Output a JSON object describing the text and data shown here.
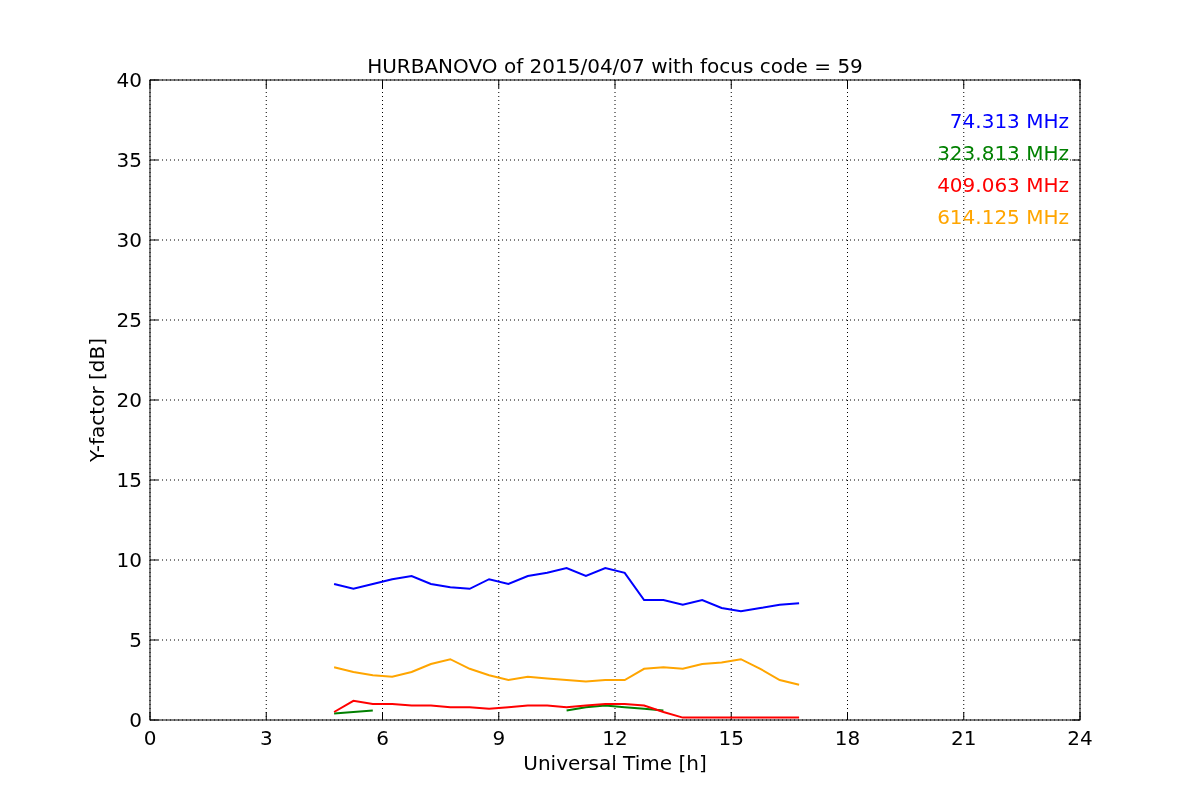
{
  "chart_data": {
    "type": "line",
    "title": "HURBANOVO of 2015/04/07 with focus code = 59",
    "xlabel": "Universal Time [h]",
    "ylabel": "Y-factor [dB]",
    "x": [
      4.75,
      5.25,
      5.75,
      6.25,
      6.75,
      7.25,
      7.75,
      8.25,
      8.75,
      9.25,
      9.75,
      10.25,
      10.75,
      11.25,
      11.75,
      12.25,
      12.75,
      13.25,
      13.75,
      14.25,
      14.75,
      15.25,
      15.75,
      16.25,
      16.75
    ],
    "series": [
      {
        "name": "74.313 MHz",
        "color": "#0000ff",
        "values": [
          8.5,
          8.2,
          8.5,
          8.8,
          9,
          8.5,
          8.3,
          8.2,
          8.8,
          8.5,
          9,
          9.2,
          9.5,
          9,
          9.5,
          9.2,
          7.5,
          7.5,
          7.2,
          7.5,
          7,
          6.8,
          7,
          7.2,
          7.3
        ]
      },
      {
        "name": "323.813 MHz",
        "color": "#008000",
        "values": [
          0.4,
          0.5,
          0.6,
          null,
          null,
          null,
          null,
          null,
          null,
          null,
          null,
          null,
          0.6,
          0.8,
          0.9,
          0.8,
          0.7,
          0.6,
          null,
          null,
          null,
          null,
          null,
          null,
          null
        ]
      },
      {
        "name": "409.063 MHz",
        "color": "#ff0000",
        "values": [
          0.5,
          1.2,
          1,
          1,
          0.9,
          0.9,
          0.8,
          0.8,
          0.7,
          0.8,
          0.9,
          0.9,
          0.8,
          0.9,
          1,
          1,
          0.9,
          0.5,
          0.15,
          0.15,
          0.15,
          0.15,
          0.15,
          0.15,
          0.15
        ]
      },
      {
        "name": "614.125 MHz",
        "color": "#ffa500",
        "values": [
          3.3,
          3,
          2.8,
          2.7,
          3,
          3.5,
          3.8,
          3.2,
          2.8,
          2.5,
          2.7,
          2.6,
          2.5,
          2.4,
          2.5,
          2.5,
          3.2,
          3.3,
          3.2,
          3.5,
          3.6,
          3.8,
          3.2,
          2.5,
          2.2
        ]
      }
    ],
    "xlim": [
      0,
      24
    ],
    "ylim": [
      0,
      40
    ],
    "xticks": [
      0,
      3,
      6,
      9,
      12,
      15,
      18,
      21,
      24
    ],
    "yticks": [
      0,
      5,
      10,
      15,
      20,
      25,
      30,
      35,
      40
    ],
    "grid": true
  }
}
